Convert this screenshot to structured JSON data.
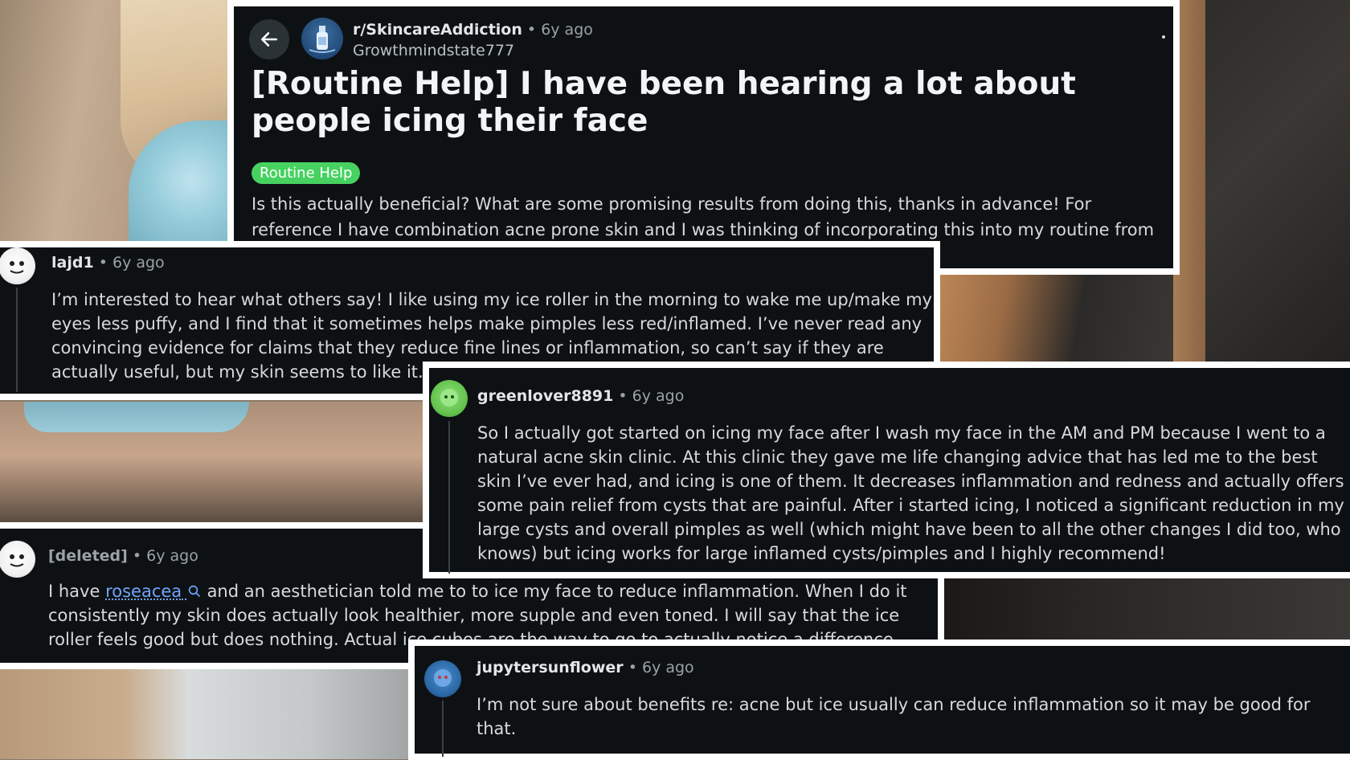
{
  "post": {
    "subreddit": "r/SkincareAddiction",
    "separator": "•",
    "age": "6y ago",
    "author": "Growthmindstate777",
    "title": "[Routine Help] I have been hearing a lot about people icing their face",
    "flair": "Routine Help",
    "body": "Is this actually beneficial? What are some promising results from doing this, thanks in advance! For reference I have combination acne prone skin and I was thinking of incorporating this into my routine from time to time.",
    "colors": {
      "flair": "#46d160",
      "background": "#0e1113",
      "text": "#d7dadc"
    }
  },
  "comments": [
    {
      "user": "lajd1",
      "age": "6y ago",
      "avatar_icon": "snoo-white-avatar",
      "body": "I’m interested to hear what others say! I like using my ice roller in the morning to wake me up/make my eyes less puffy, and I find that it sometimes helps make pimples less red/inflamed. I’ve never read any convincing evidence for claims that they reduce fine lines or inflammation, so can’t say if they are actually useful, but my skin seems to like it. 🤷‍♀️"
    },
    {
      "user": "greenlover8891",
      "age": "6y ago",
      "avatar_icon": "snoo-green-avatar",
      "body": "So I actually got started on icing my face after I wash my face in the AM and PM because I went to a natural acne skin clinic. At this clinic they gave me life changing advice that has led me to the best skin I’ve ever had, and icing is one of them. It decreases inflammation and redness and actually offers some pain relief from cysts that are painful. After i started icing, I noticed a significant reduction in my large cysts and overall pimples as well (which might have been to all the other changes I did too, who knows) but icing works for large inflamed cysts/pimples and I highly recommend!"
    },
    {
      "user": "[deleted]",
      "age": "6y ago",
      "avatar_icon": "snoo-white-avatar",
      "body_before": "I have",
      "link_text": "roseacea",
      "body_after": "and an aesthetician told me to to ice my face to reduce inflammation. When I do it consistently my skin does actually look healthier, more supple and even toned. I will say that the ice roller feels good but does nothing. Actual ice cubes are the way to go to actually notice a difference."
    },
    {
      "user": "jupytersunflower",
      "age": "6y ago",
      "avatar_icon": "snoo-blue-avatar",
      "body": "I’m not sure about benefits re: acne but ice usually can reduce inflammation so it may be good for that."
    }
  ]
}
